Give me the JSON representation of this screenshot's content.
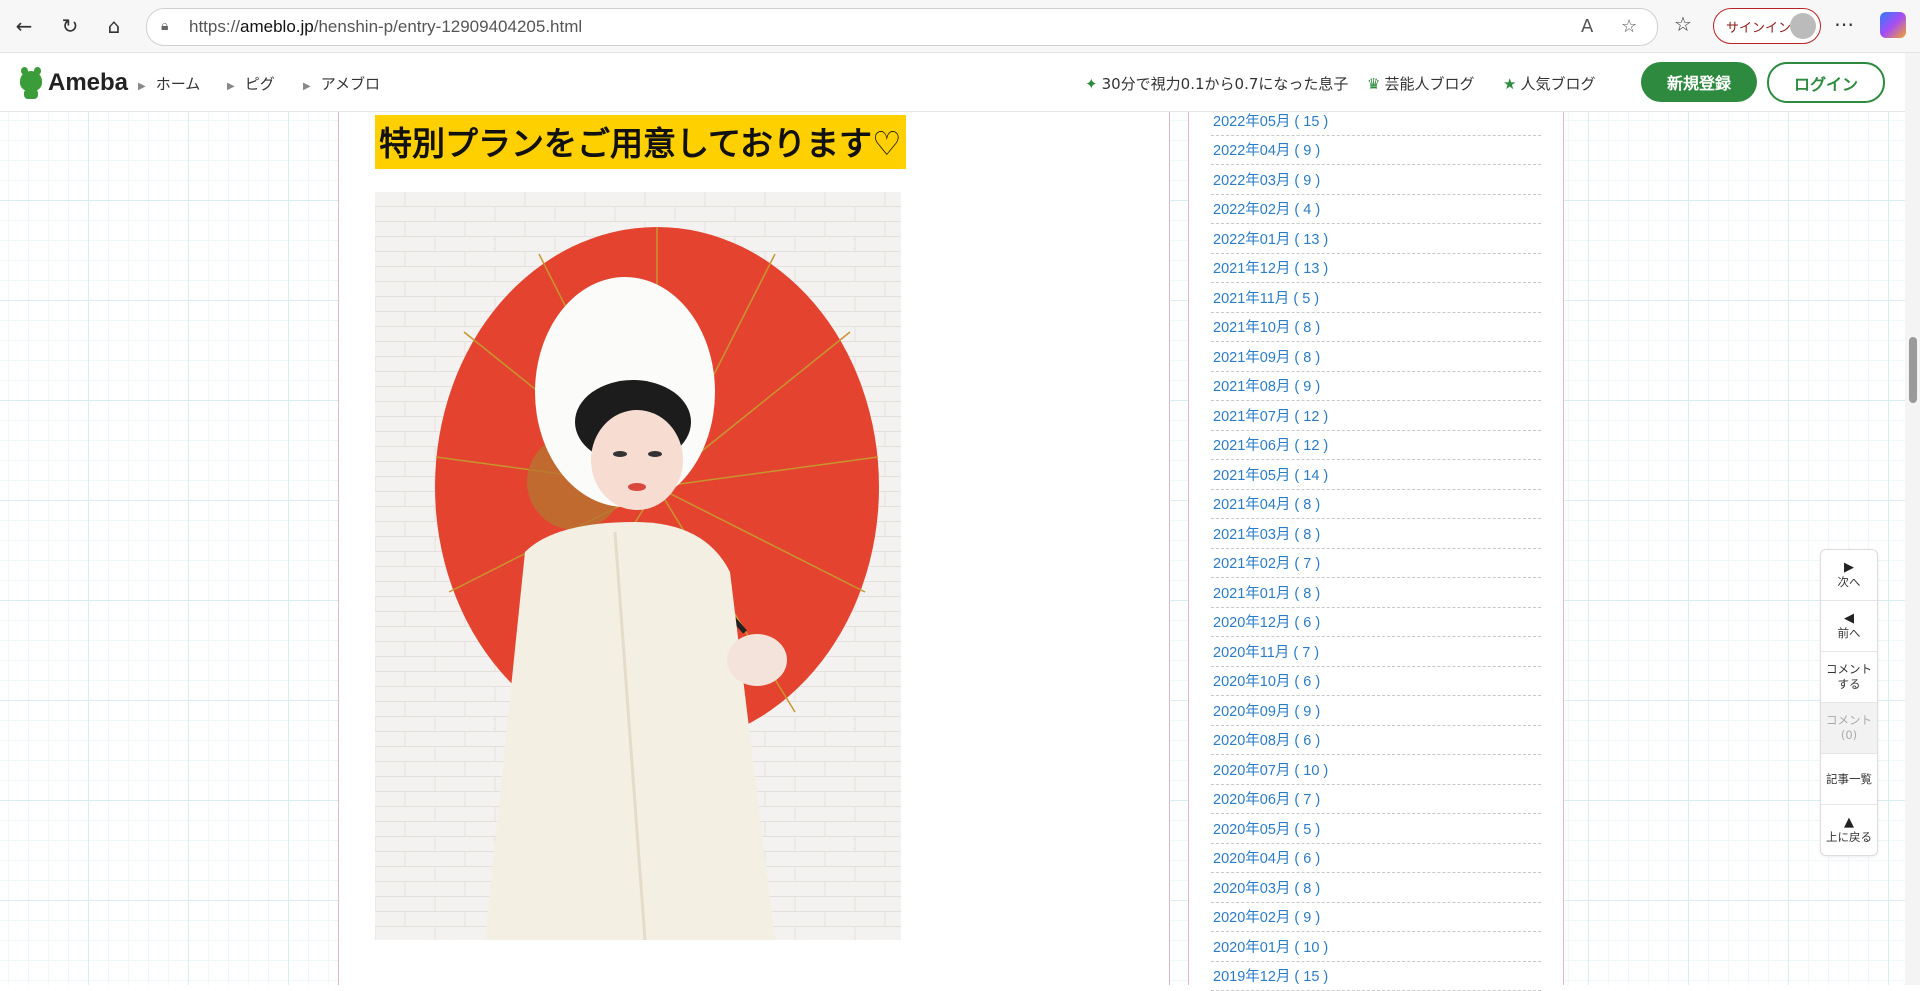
{
  "browser": {
    "url_prefix": "https://",
    "url_host": "ameblo.jp",
    "url_path": "/henshin-p/entry-12909404205.html",
    "signin_label": "サインイン"
  },
  "header": {
    "logo_text": "Ameba",
    "breadcrumbs": [
      "ホーム",
      "ピグ",
      "アメブロ"
    ],
    "links": [
      {
        "icon": "sparkle-icon",
        "glyph": "✦",
        "label": "30分で視力0.1から0.7になった息子"
      },
      {
        "icon": "crown-icon",
        "glyph": "♛",
        "label": "芸能人ブログ"
      },
      {
        "icon": "star-icon",
        "glyph": "★",
        "label": "人気ブログ"
      }
    ],
    "register_label": "新規登録",
    "login_label": "ログイン"
  },
  "post": {
    "heading": "特別プランをご用意しております♡"
  },
  "archive": [
    "2022年05月 ( 15 )",
    "2022年04月 ( 9 )",
    "2022年03月 ( 9 )",
    "2022年02月 ( 4 )",
    "2022年01月 ( 13 )",
    "2021年12月 ( 13 )",
    "2021年11月 ( 5 )",
    "2021年10月 ( 8 )",
    "2021年09月 ( 8 )",
    "2021年08月 ( 9 )",
    "2021年07月 ( 12 )",
    "2021年06月 ( 12 )",
    "2021年05月 ( 14 )",
    "2021年04月 ( 8 )",
    "2021年03月 ( 8 )",
    "2021年02月 ( 7 )",
    "2021年01月 ( 8 )",
    "2020年12月 ( 6 )",
    "2020年11月 ( 7 )",
    "2020年10月 ( 6 )",
    "2020年09月 ( 9 )",
    "2020年08月 ( 6 )",
    "2020年07月 ( 10 )",
    "2020年06月 ( 7 )",
    "2020年05月 ( 5 )",
    "2020年04月 ( 6 )",
    "2020年03月 ( 8 )",
    "2020年02月 ( 9 )",
    "2020年01月 ( 10 )",
    "2019年12月 ( 15 )"
  ],
  "float_nav": {
    "next": "次へ",
    "prev": "前へ",
    "comment_line1": "コメント",
    "comment_line2": "する",
    "comments_line1": "コメント",
    "comments_count": "(0)",
    "entry_list": "記事一覧",
    "to_top": "上に戻る"
  },
  "colors": {
    "ameba_green": "#2d8a3e",
    "heading_highlight": "#ffd000",
    "link_blue": "#2a7cc7"
  }
}
